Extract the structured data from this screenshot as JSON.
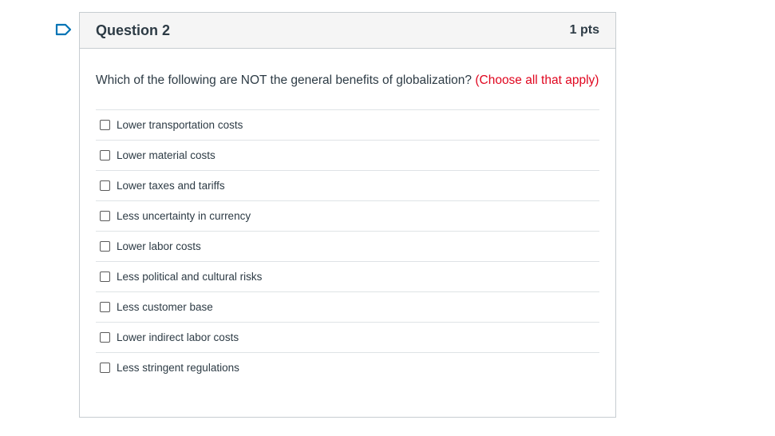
{
  "question": {
    "title": "Question 2",
    "points": "1 pts",
    "text": "Which of the following are NOT the general benefits of globalization?",
    "instruction": "(Choose all that apply)",
    "answers": [
      {
        "label": "Lower transportation costs",
        "checked": false
      },
      {
        "label": "Lower material costs",
        "checked": false
      },
      {
        "label": "Lower taxes and tariffs",
        "checked": false
      },
      {
        "label": "Less uncertainty in currency",
        "checked": false
      },
      {
        "label": "Lower labor costs",
        "checked": false
      },
      {
        "label": "Less political and cultural risks",
        "checked": false
      },
      {
        "label": "Less customer base",
        "checked": false
      },
      {
        "label": "Lower indirect labor costs",
        "checked": false
      },
      {
        "label": "Less stringent regulations",
        "checked": false
      }
    ]
  },
  "colors": {
    "flag": "#0374b5",
    "instruction": "#e0061f",
    "header_bg": "#f5f5f5",
    "border": "#c7cdd1"
  },
  "icons": {
    "flag": "bookmark-flag-icon"
  }
}
